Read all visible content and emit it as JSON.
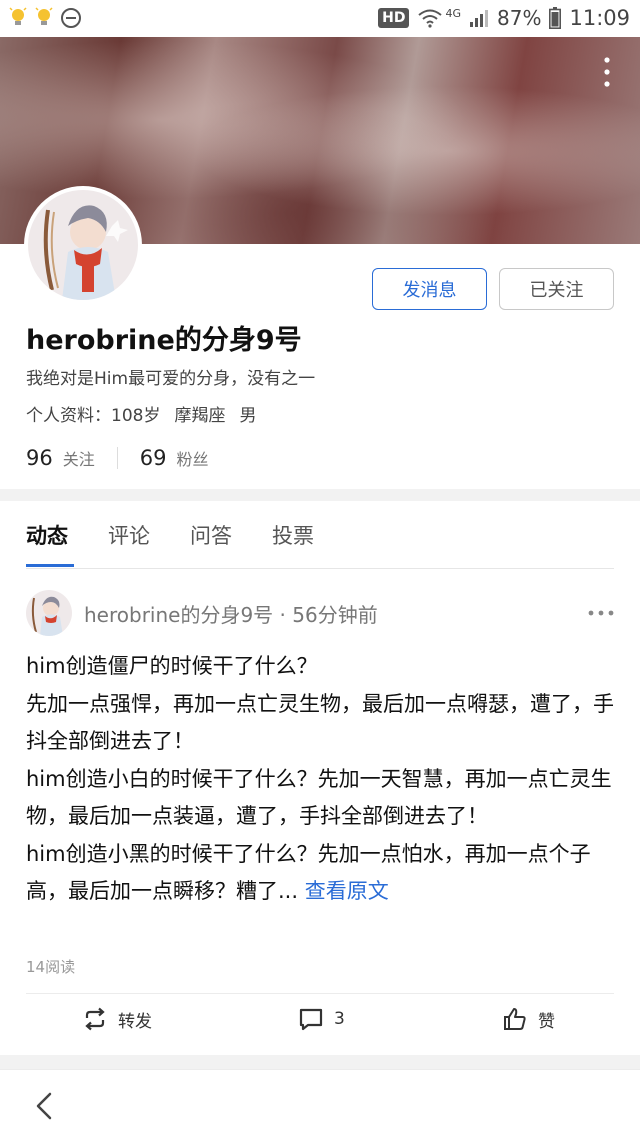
{
  "status_bar": {
    "network_badge": "HD",
    "network_type": "4G",
    "battery": "87%",
    "time": "11:09"
  },
  "profile": {
    "name": "herobrine的分身9号",
    "bio": "我绝对是Him最可爱的分身，没有之一",
    "info_label": "个人资料：108岁",
    "zodiac": "摩羯座",
    "gender": "男",
    "following_count": "96",
    "following_label": "关注",
    "followers_count": "69",
    "followers_label": "粉丝"
  },
  "buttons": {
    "message": "发消息",
    "followed": "已关注"
  },
  "tabs": [
    {
      "label": "动态",
      "active": true
    },
    {
      "label": "评论",
      "active": false
    },
    {
      "label": "问答",
      "active": false
    },
    {
      "label": "投票",
      "active": false
    }
  ],
  "post": {
    "author_line": "herobrine的分身9号 · 56分钟前",
    "lines": [
      "him创造僵尸的时候干了什么？",
      "先加一点强悍，再加一点亡灵生物，最后加一点嘚瑟，遭了，手抖全部倒进去了！",
      "him创造小白的时候干了什么？先加一天智慧，再加一点亡灵生物，最后加一点装逼，遭了，手抖全部倒进去了！"
    ],
    "last_line": "him创造小黑的时候干了什么？先加一点怕水，再加一点个子高，最后加一点瞬移？糟了...",
    "read_more": "查看原文",
    "read_count": "14阅读"
  },
  "actions": {
    "repost": "转发",
    "comment_count": "3",
    "like": "赞"
  },
  "colors": {
    "accent": "#2a6cd6",
    "text": "#111111",
    "muted": "#777777"
  }
}
